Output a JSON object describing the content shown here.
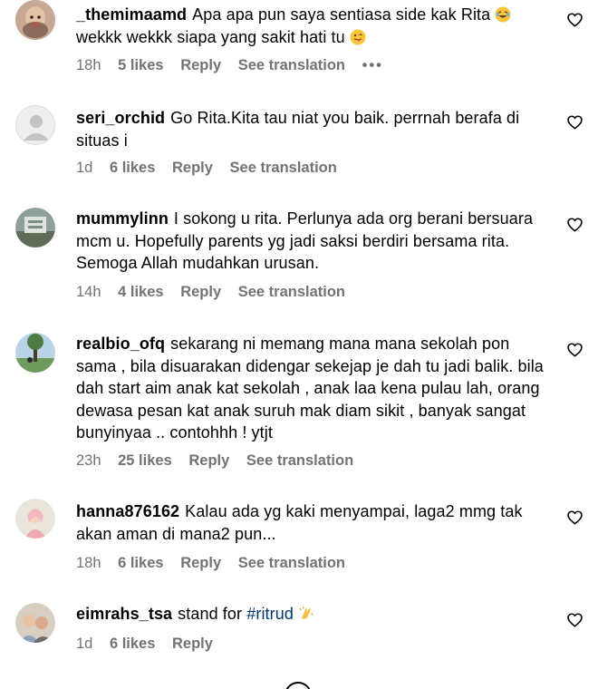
{
  "comments": [
    {
      "username": "_themimaamd",
      "text": "Apa apa pun saya sentiasa side kak Rita",
      "text_tail": "wekkk wekkk siapa yang sakit hati tu",
      "emoji1": "laughing-with-tears",
      "emoji2": "tongue-out",
      "time": "18h",
      "likes": "5 likes",
      "reply": "Reply",
      "translate": "See translation",
      "more": "•••"
    },
    {
      "username": "seri_orchid",
      "text": "Go Rita.Kita tau niat you baik. perrnah berafa di situas i",
      "time": "1d",
      "likes": "6 likes",
      "reply": "Reply",
      "translate": "See translation"
    },
    {
      "username": "mummylinn",
      "text": "I sokong u rita. Perlunya ada org berani bersuara mcm u. Hopefully parents yg jadi saksi berdiri bersama rita. Semoga Allah mudahkan urusan.",
      "time": "14h",
      "likes": "4 likes",
      "reply": "Reply",
      "translate": "See translation"
    },
    {
      "username": "realbio_ofq",
      "text": "sekarang ni memang mana mana sekolah pon sama , bila disuarakan didengar sekejap je dah tu jadi balik. bila dah start aim anak kat sekolah , anak laa kena pulau lah, orang dewasa pesan kat anak suruh mak diam sikit , banyak sangat bunyinyaa .. contohhh ! ytjt",
      "time": "23h",
      "likes": "25 likes",
      "reply": "Reply",
      "translate": "See translation"
    },
    {
      "username": "hanna876162",
      "text": "Kalau ada yg kaki menyampai, laga2 mmg tak akan aman di mana2 pun...",
      "time": "18h",
      "likes": "6 likes",
      "reply": "Reply",
      "translate": "See translation"
    },
    {
      "username": "eimrahs_tsa",
      "text": "stand for",
      "hashtag": "#ritrud",
      "emoji1": "clapping-hands",
      "time": "1d",
      "likes": "6 likes",
      "reply": "Reply"
    }
  ],
  "colors": {
    "text": "#000000",
    "meta": "#737373",
    "hashtag": "#00376b"
  }
}
